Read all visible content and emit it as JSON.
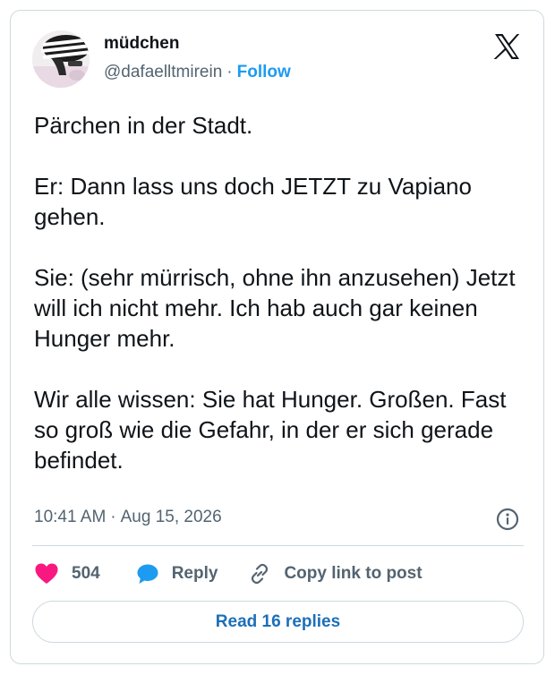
{
  "tweet": {
    "author": {
      "display_name": "müdchen",
      "handle": "@dafaelltmirein",
      "follow_label": "Follow",
      "avatar_icon": "avatar-striped-figure"
    },
    "logo_icon": "x-logo-icon",
    "paragraphs": [
      "Pärchen in der Stadt.",
      "Er: Dann lass uns doch JETZT zu Vapiano gehen.",
      "Sie: (sehr mürrisch, ohne ihn anzusehen) Jetzt will ich nicht mehr. Ich hab auch gar keinen Hunger mehr.",
      "Wir alle wissen: Sie hat Hunger. Großen. Fast so groß wie die Gefahr, in der er sich gerade befindet."
    ],
    "time": "10:41 AM",
    "separator": "·",
    "date": "Aug 15, 2026",
    "info_icon": "info-icon"
  },
  "actions": {
    "like_count": "504",
    "reply_label": "Reply",
    "copy_label": "Copy link to post"
  },
  "read_replies_label": "Read 16 replies",
  "colors": {
    "accent": "#1d9bf0",
    "like": "#f91880",
    "secondary_text": "#536471",
    "border": "#cfd9de"
  }
}
